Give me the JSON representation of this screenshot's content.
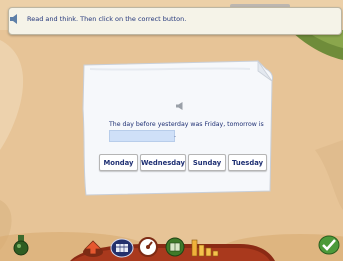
{
  "instruction": {
    "text": "Read and think. Then click on the correct button.",
    "icon": "speaker-icon"
  },
  "question": {
    "sentence": "The day before yesterday was Friday, tomorrow is",
    "answer_value": "",
    "end_punctuation": "."
  },
  "choices": [
    "Monday",
    "Wednesday",
    "Sunday",
    "Tuesday"
  ],
  "toolbar": {
    "icons": [
      "potion-bottle-icon",
      "back-arrow-icon",
      "calendar-icon",
      "dial-icon",
      "book-icon",
      "bar-chart-icon",
      "check-icon"
    ]
  },
  "colors": {
    "text": "#1e2f73",
    "sand": "#e9c79a",
    "ocean": "#f2dbb8",
    "grass": "#6f8c3a",
    "toolbar": "#8b2a14"
  }
}
